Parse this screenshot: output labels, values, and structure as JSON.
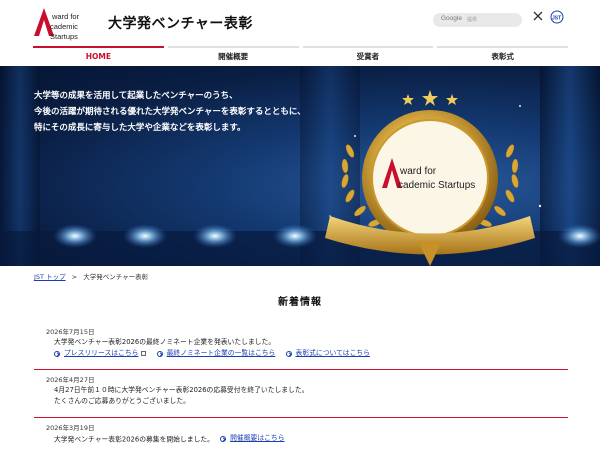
{
  "header": {
    "logo_line1": "ward for",
    "logo_line2": "cademic Startups",
    "site_title": "大学発ベンチャー表彰",
    "search_brand": "Google",
    "search_placeholder": "提供",
    "x_label": "X",
    "jst_label": "JST"
  },
  "nav": {
    "items": [
      {
        "label": "HOME",
        "active": true
      },
      {
        "label": "開催概要",
        "active": false
      },
      {
        "label": "受賞者",
        "active": false
      },
      {
        "label": "表彰式",
        "active": false
      }
    ]
  },
  "hero": {
    "lines": [
      "大学等の成果を活用して起業したベンチャーのうち、",
      "今後の活躍が期待される優れた大学発ベンチャーを表彰するとともに、",
      "特にその成長に寄与した大学や企業などを表彰します。"
    ],
    "badge_line1": "ward for",
    "badge_line2": "cademic Startups"
  },
  "breadcrumb": {
    "home": "JST トップ",
    "separator": ">",
    "current": "大学発ベンチャー表彰"
  },
  "news": {
    "title": "新着情報",
    "items": [
      {
        "date": "2026年7月15日",
        "lines": [
          "大学発ベンチャー表彰2026の最終ノミネート企業を発表いたしました。"
        ],
        "links": [
          "プレスリリースはこちら",
          "最終ノミネート企業の一覧はこちら",
          "表彰式についてはこちら"
        ],
        "inline_link": ""
      },
      {
        "date": "2026年4月27日",
        "lines": [
          "4月27日午前１０時に大学発ベンチャー表彰2026の応募受付を終了いたしました。",
          "たくさんのご応募ありがとうございました。"
        ],
        "links": [],
        "inline_link": ""
      },
      {
        "date": "2026年3月19日",
        "lines": [
          "大学発ベンチャー表彰2026の募集を開始しました。"
        ],
        "links": [],
        "inline_link": "開催概要はこちら"
      }
    ]
  },
  "colors": {
    "accent": "#c8102e",
    "link": "#1a3fb0",
    "hero_dark": "#0a1f45",
    "gold": "#d4a437"
  }
}
